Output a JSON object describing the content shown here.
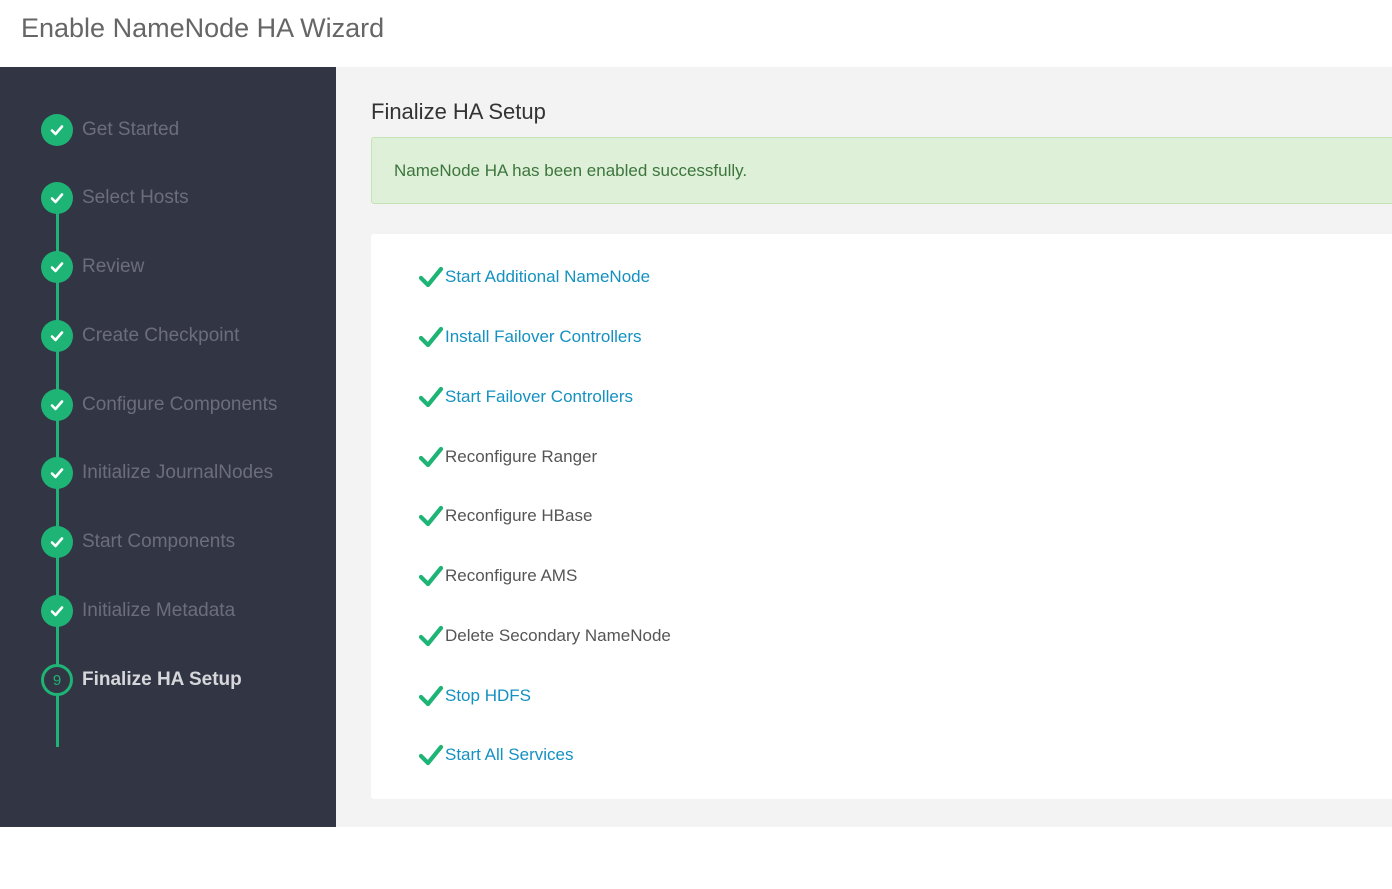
{
  "header": {
    "title": "Enable NameNode HA Wizard"
  },
  "sidebar": {
    "steps": [
      {
        "label": "Get Started",
        "status": "done"
      },
      {
        "label": "Select Hosts",
        "status": "done"
      },
      {
        "label": "Review",
        "status": "done"
      },
      {
        "label": "Create Checkpoint",
        "status": "done"
      },
      {
        "label": "Configure Components",
        "status": "done"
      },
      {
        "label": "Initialize JournalNodes",
        "status": "done"
      },
      {
        "label": "Start Components",
        "status": "done"
      },
      {
        "label": "Initialize Metadata",
        "status": "done"
      },
      {
        "label": "Finalize HA Setup",
        "status": "current",
        "number": "9"
      }
    ]
  },
  "main": {
    "title": "Finalize HA Setup",
    "alert": "NameNode HA has been enabled successfully.",
    "tasks": [
      {
        "label": "Start Additional NameNode",
        "link": true
      },
      {
        "label": "Install Failover Controllers",
        "link": true
      },
      {
        "label": "Start Failover Controllers",
        "link": true
      },
      {
        "label": "Reconfigure Ranger",
        "link": false
      },
      {
        "label": "Reconfigure HBase",
        "link": false
      },
      {
        "label": "Reconfigure AMS",
        "link": false
      },
      {
        "label": "Delete Secondary NameNode",
        "link": false
      },
      {
        "label": "Stop HDFS",
        "link": true
      },
      {
        "label": "Start All Services",
        "link": true
      }
    ]
  },
  "colors": {
    "accent": "#1eb475",
    "sidebar_bg": "#323544",
    "link": "#1491c1",
    "alert_bg": "#dff0d8",
    "alert_text": "#3c763d"
  },
  "icons": {
    "step_done": "check-circle-icon",
    "task_done": "checkmark-icon"
  }
}
